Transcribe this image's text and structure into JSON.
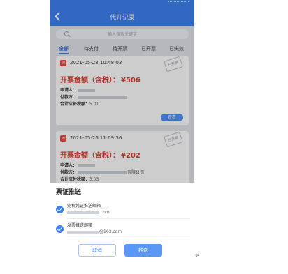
{
  "header": {
    "title": "代开记录"
  },
  "search": {
    "placeholder": "输入搜索关键字"
  },
  "tabs": [
    {
      "label": "全部",
      "active": true
    },
    {
      "label": "待支付"
    },
    {
      "label": "待开票"
    },
    {
      "label": "已开票"
    },
    {
      "label": "已失效"
    }
  ],
  "records": [
    {
      "time": "2021-05-28 10:48:03",
      "amount_label": "开票金额（含税）：",
      "amount_value": "¥506",
      "stamp": "已开票",
      "applicant_label": "申请人：",
      "payer_label": "付款方：",
      "tax_label": "合计应补税额：",
      "tax_value": "5.01",
      "view_label": "查看"
    },
    {
      "time": "2021-05-26 11:09:36",
      "amount_label": "开票金额（含税）：",
      "amount_value": "¥202",
      "stamp": "已开票",
      "applicant_label": "申请人：",
      "payer_label": "付款方：",
      "payer_suffix": "有限公司",
      "tax_label": "合计应补税额：",
      "tax_value": "3.03"
    }
  ],
  "sheet": {
    "title": "票证推送",
    "options": [
      {
        "label": "完税凭证推送邮箱",
        "email_suffix": ".com",
        "checked": true
      },
      {
        "label": "发票推送邮箱",
        "email_suffix": "@163.com",
        "checked": true
      }
    ],
    "cancel_label": "取消",
    "push_label": "推送"
  },
  "colors": {
    "accent": "#3d7ff0",
    "amount": "#d63a2f"
  }
}
